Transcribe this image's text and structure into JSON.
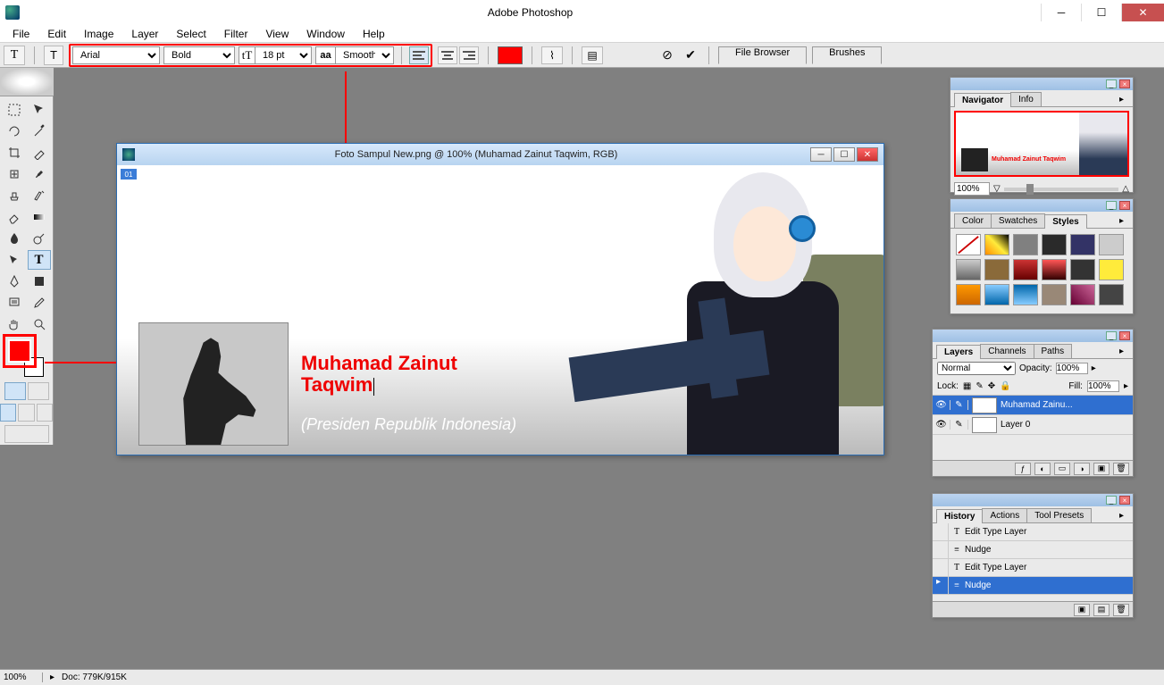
{
  "app": {
    "title": "Adobe Photoshop"
  },
  "menu": [
    "File",
    "Edit",
    "Image",
    "Layer",
    "Select",
    "Filter",
    "View",
    "Window",
    "Help"
  ],
  "options": {
    "tool_indicator": "T",
    "orientation": "⸆T",
    "font_family": "Arial",
    "font_style": "Bold",
    "font_size": "18 pt",
    "aa_label": "aa",
    "aa_mode": "Smooth",
    "color": "#ff0000",
    "tabs": {
      "file_browser": "File Browser",
      "brushes": "Brushes"
    }
  },
  "document": {
    "title": "Foto Sampul New.png @ 100% (Muhamad Zainut Taqwim, RGB)",
    "slice": "01",
    "text_layer": "Muhamad Zainut\nTaqwim",
    "text_line1": "Muhamad Zainut",
    "text_line2": "Taqwim",
    "subtitle": "(Presiden Republik Indonesia)"
  },
  "navigator": {
    "tab_nav": "Navigator",
    "tab_info": "Info",
    "zoom": "100%",
    "mini_text": "Muhamad Zainut\nTaqwim"
  },
  "color_panel": {
    "tab_color": "Color",
    "tab_swatches": "Swatches",
    "tab_styles": "Styles"
  },
  "style_swatches": [
    "#ffffff",
    "linear-gradient(45deg,#ff8c00,#ffeb3b,#000)",
    "#808080",
    "#2a2a2a",
    "#333366",
    "#cccccc",
    "linear-gradient(#ccc,#666)",
    "#8a6a3a",
    "linear-gradient(#c33,#600)",
    "linear-gradient(#f55,#300)",
    "#333",
    "#ffeb3b",
    "linear-gradient(#f90,#c60)",
    "linear-gradient(#8cf,#06a)",
    "linear-gradient(#06a,#8cf)",
    "#998877",
    "linear-gradient(45deg,#603,#c69)",
    "#444"
  ],
  "layers": {
    "tab_layers": "Layers",
    "tab_channels": "Channels",
    "tab_paths": "Paths",
    "blend_mode": "Normal",
    "opacity_label": "Opacity:",
    "opacity": "100%",
    "lock_label": "Lock:",
    "fill_label": "Fill:",
    "fill": "100%",
    "items": [
      {
        "name": "Muhamad Zainu...",
        "type": "T",
        "selected": true
      },
      {
        "name": "Layer 0",
        "type": "img",
        "selected": false
      }
    ]
  },
  "history": {
    "tab_history": "History",
    "tab_actions": "Actions",
    "tab_presets": "Tool Presets",
    "items": [
      {
        "icon": "T",
        "label": "Edit Type Layer",
        "selected": false
      },
      {
        "icon": "≡",
        "label": "Nudge",
        "selected": false
      },
      {
        "icon": "T",
        "label": "Edit Type Layer",
        "selected": false
      },
      {
        "icon": "≡",
        "label": "Nudge",
        "selected": true
      }
    ]
  },
  "status": {
    "zoom": "100%",
    "doc": "Doc: 779K/915K"
  }
}
